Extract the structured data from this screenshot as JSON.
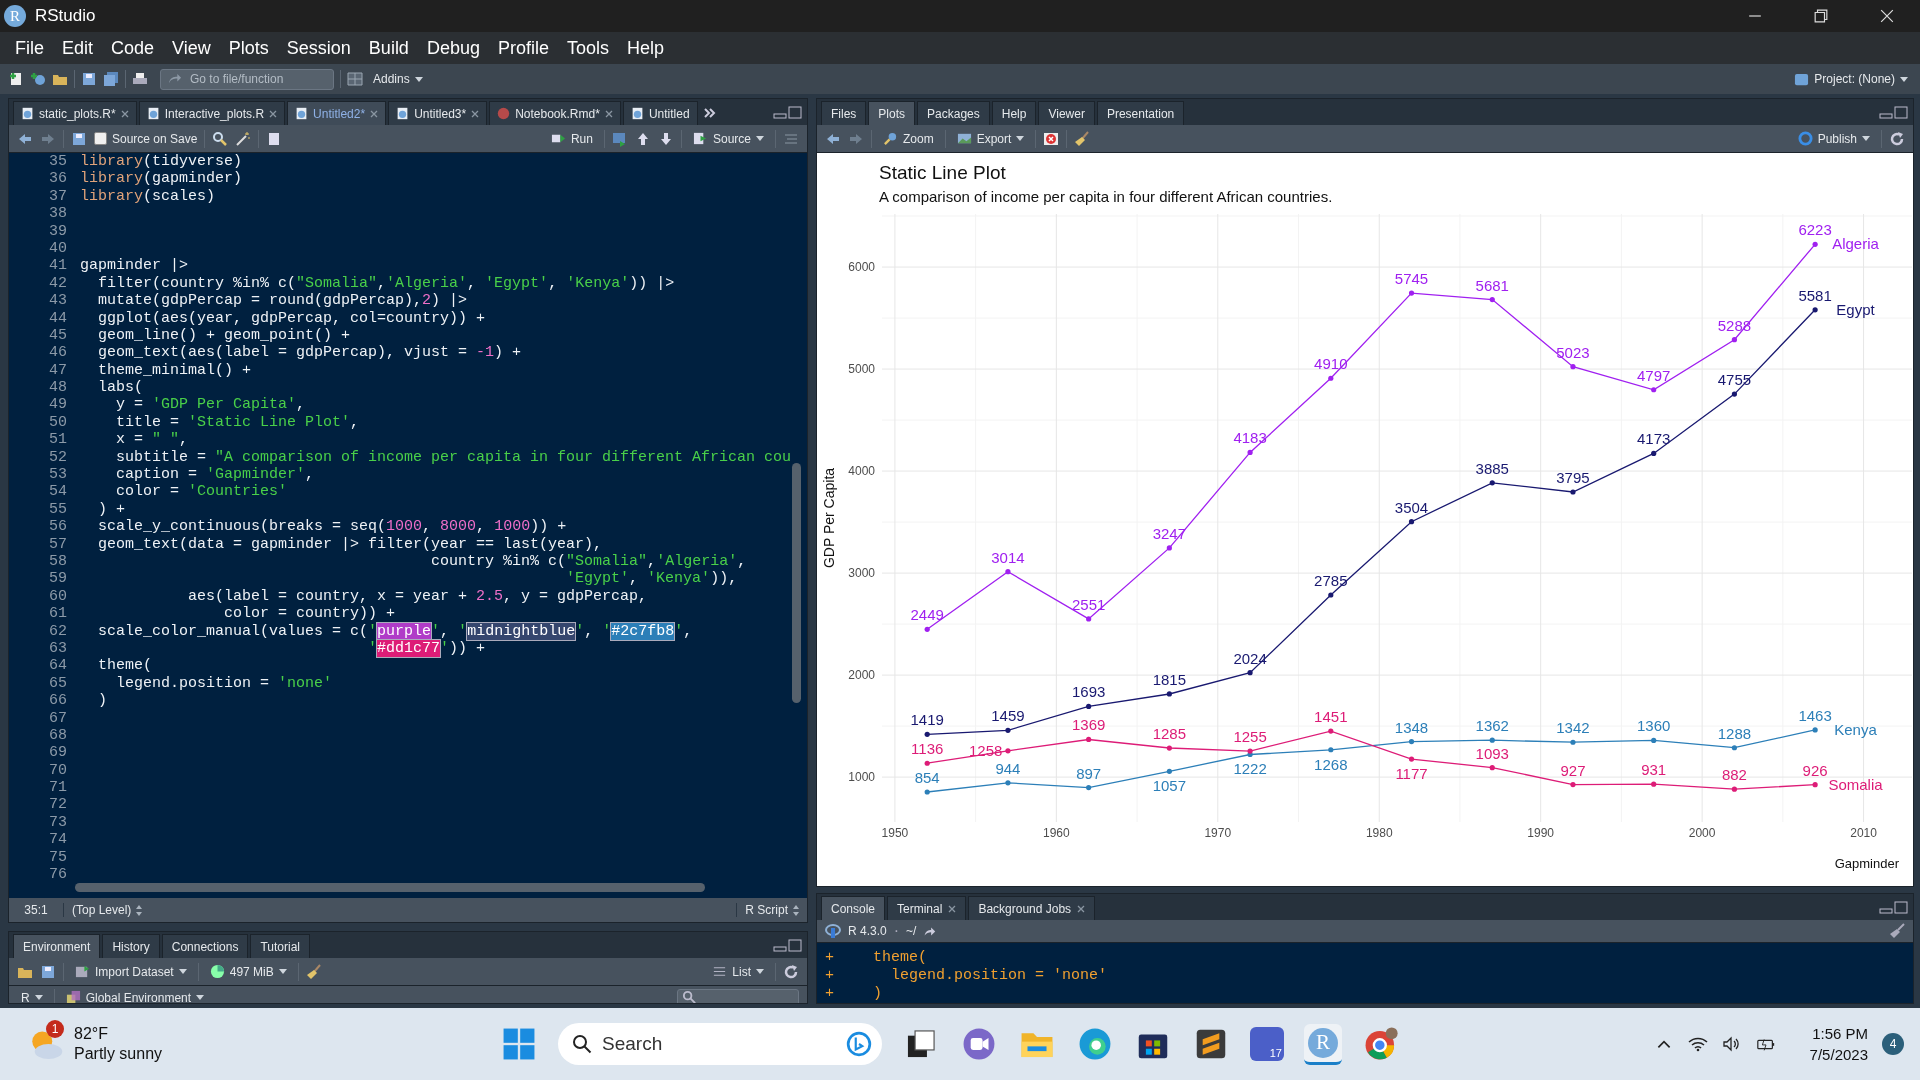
{
  "window": {
    "title": "RStudio",
    "logo_letter": "R"
  },
  "menu": [
    "File",
    "Edit",
    "Code",
    "View",
    "Plots",
    "Session",
    "Build",
    "Debug",
    "Profile",
    "Tools",
    "Help"
  ],
  "toolbar": {
    "goto_placeholder": "Go to file/function",
    "addins": "Addins",
    "project": "Project: (None)"
  },
  "editor": {
    "tabs": [
      {
        "label": "static_plots.R*",
        "kind": "r",
        "selected": false,
        "closable": true
      },
      {
        "label": "Interactive_plots.R",
        "kind": "r",
        "selected": false,
        "closable": true
      },
      {
        "label": "Untitled2*",
        "kind": "r",
        "selected": true,
        "closable": true
      },
      {
        "label": "Untitled3*",
        "kind": "r",
        "selected": false,
        "closable": true
      },
      {
        "label": "Notebook.Rmd*",
        "kind": "rmd",
        "selected": false,
        "closable": true
      },
      {
        "label": "Untitled",
        "kind": "r",
        "selected": false,
        "closable": false
      }
    ],
    "source_on_save": {
      "label": "Source on Save",
      "checked": false
    },
    "run": "Run",
    "source": "Source",
    "lines": [
      {
        "n": "35",
        "tokens": [
          {
            "kind": "fn",
            "text": "library"
          },
          {
            "kind": "code",
            "text": "(tidyverse)"
          }
        ]
      },
      {
        "n": "36",
        "tokens": [
          {
            "kind": "fn",
            "text": "library"
          },
          {
            "kind": "code",
            "text": "(gapminder)"
          }
        ]
      },
      {
        "n": "37",
        "tokens": [
          {
            "kind": "fn",
            "text": "library"
          },
          {
            "kind": "code",
            "text": "(scales)"
          }
        ]
      },
      {
        "n": "38"
      },
      {
        "n": "39"
      },
      {
        "n": "40"
      },
      {
        "n": "41",
        "tokens": [
          {
            "kind": "code",
            "text": "gapminder |>"
          }
        ]
      },
      {
        "n": "42",
        "tokens": [
          {
            "kind": "code",
            "text": "  filter(country %in% c("
          },
          {
            "kind": "str",
            "text": "\"Somalia\""
          },
          {
            "kind": "code",
            "text": ","
          },
          {
            "kind": "str",
            "text": "'Algeria'"
          },
          {
            "kind": "code",
            "text": ", "
          },
          {
            "kind": "str",
            "text": "'Egypt'"
          },
          {
            "kind": "code",
            "text": ", "
          },
          {
            "kind": "str",
            "text": "'Kenya'"
          },
          {
            "kind": "code",
            "text": ")) |>"
          }
        ]
      },
      {
        "n": "43",
        "tokens": [
          {
            "kind": "code",
            "text": "  mutate(gdpPercap = round(gdpPercap),"
          },
          {
            "kind": "num",
            "text": "2"
          },
          {
            "kind": "code",
            "text": ") |>"
          }
        ]
      },
      {
        "n": "44",
        "tokens": [
          {
            "kind": "code",
            "text": "  ggplot(aes(year, gdpPercap, col=country)) +"
          }
        ]
      },
      {
        "n": "45",
        "tokens": [
          {
            "kind": "code",
            "text": "  geom_line() + geom_point() +"
          }
        ]
      },
      {
        "n": "46",
        "tokens": [
          {
            "kind": "code",
            "text": "  geom_text(aes(label = gdpPercap), vjust = "
          },
          {
            "kind": "num",
            "text": "-1"
          },
          {
            "kind": "code",
            "text": ") +"
          }
        ]
      },
      {
        "n": "47",
        "tokens": [
          {
            "kind": "code",
            "text": "  theme_minimal() +"
          }
        ]
      },
      {
        "n": "48",
        "tokens": [
          {
            "kind": "code",
            "text": "  labs("
          }
        ]
      },
      {
        "n": "49",
        "tokens": [
          {
            "kind": "code",
            "text": "    y = "
          },
          {
            "kind": "str",
            "text": "'GDP Per Capita'"
          },
          {
            "kind": "code",
            "text": ","
          }
        ]
      },
      {
        "n": "50",
        "tokens": [
          {
            "kind": "code",
            "text": "    title = "
          },
          {
            "kind": "str",
            "text": "'Static Line Plot'"
          },
          {
            "kind": "code",
            "text": ","
          }
        ]
      },
      {
        "n": "51",
        "tokens": [
          {
            "kind": "code",
            "text": "    x = "
          },
          {
            "kind": "str",
            "text": "\" \""
          },
          {
            "kind": "code",
            "text": ","
          }
        ]
      },
      {
        "n": "52",
        "tokens": [
          {
            "kind": "code",
            "text": "    subtitle = "
          },
          {
            "kind": "str",
            "text": "\"A comparison of income per capita in four different African cou"
          }
        ]
      },
      {
        "n": "53",
        "tokens": [
          {
            "kind": "code",
            "text": "    caption = "
          },
          {
            "kind": "str",
            "text": "'Gapminder'"
          },
          {
            "kind": "code",
            "text": ","
          }
        ]
      },
      {
        "n": "54",
        "tokens": [
          {
            "kind": "code",
            "text": "    color = "
          },
          {
            "kind": "str",
            "text": "'Countries'"
          }
        ]
      },
      {
        "n": "55",
        "tokens": [
          {
            "kind": "code",
            "text": "  ) +"
          }
        ]
      },
      {
        "n": "56",
        "tokens": [
          {
            "kind": "code",
            "text": "  scale_y_continuous(breaks = seq("
          },
          {
            "kind": "num",
            "text": "1000"
          },
          {
            "kind": "code",
            "text": ", "
          },
          {
            "kind": "num",
            "text": "8000"
          },
          {
            "kind": "code",
            "text": ", "
          },
          {
            "kind": "num",
            "text": "1000"
          },
          {
            "kind": "code",
            "text": ")) +"
          }
        ]
      },
      {
        "n": "57",
        "tokens": [
          {
            "kind": "code",
            "text": "  geom_text(data = gapminder |> filter(year == last(year),"
          }
        ]
      },
      {
        "n": "58",
        "tokens": [
          {
            "kind": "code",
            "text": "                                       country %in% c("
          },
          {
            "kind": "str",
            "text": "\"Somalia\""
          },
          {
            "kind": "code",
            "text": ","
          },
          {
            "kind": "str",
            "text": "'Algeria'"
          },
          {
            "kind": "code",
            "text": ","
          }
        ]
      },
      {
        "n": "59",
        "tokens": [
          {
            "kind": "str",
            "text": "                                                      'Egypt'"
          },
          {
            "kind": "code",
            "text": ", "
          },
          {
            "kind": "str",
            "text": "'Kenya'"
          },
          {
            "kind": "code",
            "text": ")),"
          }
        ]
      },
      {
        "n": "60",
        "tokens": [
          {
            "kind": "code",
            "text": "            aes(label = country, x = year + "
          },
          {
            "kind": "num",
            "text": "2.5"
          },
          {
            "kind": "code",
            "text": ", y = gdpPercap,"
          }
        ]
      },
      {
        "n": "61",
        "tokens": [
          {
            "kind": "code",
            "text": "                color = country)) +"
          }
        ]
      },
      {
        "n": "62",
        "tokens": [
          {
            "kind": "code",
            "text": "  scale_color_manual(values = c("
          },
          {
            "kind": "str",
            "text": "'"
          },
          {
            "kind": "swatch",
            "text": "purple",
            "color": "#b03cc8"
          },
          {
            "kind": "str",
            "text": "'"
          },
          {
            "kind": "code",
            "text": ", "
          },
          {
            "kind": "str",
            "text": "'"
          },
          {
            "kind": "swatch",
            "text": "midnightblue",
            "color": "#35466e"
          },
          {
            "kind": "str",
            "text": "'"
          },
          {
            "kind": "code",
            "text": ", "
          },
          {
            "kind": "str",
            "text": "'"
          },
          {
            "kind": "swatch",
            "text": "#2c7fb8",
            "color": "#2c7fb8"
          },
          {
            "kind": "str",
            "text": "'"
          },
          {
            "kind": "code",
            "text": ","
          }
        ]
      },
      {
        "n": "63",
        "tokens": [
          {
            "kind": "str",
            "text": "                                '"
          },
          {
            "kind": "swatch",
            "text": "#dd1c77",
            "color": "#dd1c77"
          },
          {
            "kind": "str",
            "text": "'"
          },
          {
            "kind": "code",
            "text": ")) +"
          }
        ]
      },
      {
        "n": "64",
        "tokens": [
          {
            "kind": "code",
            "text": "  theme("
          }
        ]
      },
      {
        "n": "65",
        "tokens": [
          {
            "kind": "code",
            "text": "    legend.position = "
          },
          {
            "kind": "str",
            "text": "'none'"
          }
        ]
      },
      {
        "n": "66",
        "tokens": [
          {
            "kind": "code",
            "text": "  )"
          }
        ]
      },
      {
        "n": "67"
      },
      {
        "n": "68"
      },
      {
        "n": "69"
      },
      {
        "n": "70"
      },
      {
        "n": "71"
      },
      {
        "n": "72"
      },
      {
        "n": "73"
      },
      {
        "n": "74"
      },
      {
        "n": "75"
      },
      {
        "n": "76"
      }
    ],
    "status": {
      "position": "35:1",
      "scope": "(Top Level)",
      "file_type": "R Script"
    }
  },
  "environment": {
    "tabs": [
      {
        "label": "Environment",
        "selected": true
      },
      {
        "label": "History",
        "selected": false
      },
      {
        "label": "Connections",
        "selected": false
      },
      {
        "label": "Tutorial",
        "selected": false
      }
    ],
    "import": "Import Dataset",
    "memory": "497 MiB",
    "view": "List",
    "language": "R",
    "scope": "Global Environment"
  },
  "plots": {
    "tabs": [
      {
        "label": "Files",
        "selected": false
      },
      {
        "label": "Plots",
        "selected": true
      },
      {
        "label": "Packages",
        "selected": false
      },
      {
        "label": "Help",
        "selected": false
      },
      {
        "label": "Viewer",
        "selected": false
      },
      {
        "label": "Presentation",
        "selected": false
      }
    ],
    "zoom": "Zoom",
    "export": "Export",
    "publish": "Publish",
    "subtitle": "A comparison of income per capita in four different African countries.",
    "caption": "Gapminder",
    "chart_data": {
      "type": "line",
      "title": "Static Line Plot",
      "ylabel": "GDP Per Capita",
      "x": [
        1952,
        1957,
        1962,
        1967,
        1972,
        1977,
        1982,
        1987,
        1992,
        1997,
        2002,
        2007
      ],
      "series": [
        {
          "name": "Algeria",
          "color": "#a020f0",
          "values": [
            2449,
            3014,
            2551,
            3247,
            4183,
            4910,
            5745,
            5681,
            5023,
            4797,
            5288,
            6223
          ]
        },
        {
          "name": "Egypt",
          "color": "#191970",
          "values": [
            1419,
            1459,
            1693,
            1815,
            2024,
            2785,
            3504,
            3885,
            3795,
            4173,
            4755,
            5581
          ]
        },
        {
          "name": "Kenya",
          "color": "#2c7fb8",
          "values": [
            854,
            944,
            897,
            1057,
            1222,
            1268,
            1348,
            1362,
            1342,
            1360,
            1288,
            1463
          ]
        },
        {
          "name": "Somalia",
          "color": "#dd1c77",
          "values": [
            1136,
            1258,
            1369,
            1285,
            1255,
            1451,
            1177,
            1093,
            927,
            931,
            882,
            926
          ]
        }
      ],
      "xlim": [
        1949.2,
        2013
      ],
      "ylim": [
        560,
        6520
      ],
      "xticks": [
        1950,
        1960,
        1970,
        1980,
        1990,
        2000,
        2010
      ],
      "yticks": [
        1000,
        2000,
        3000,
        4000,
        5000,
        6000
      ],
      "grid": true,
      "data_labels": true
    }
  },
  "console": {
    "tabs": [
      {
        "label": "Console",
        "selected": true,
        "closable": false
      },
      {
        "label": "Terminal",
        "selected": false,
        "closable": true
      },
      {
        "label": "Background Jobs",
        "selected": false,
        "closable": true
      }
    ],
    "version": "R 4.3.0",
    "separator": "·",
    "path": "~/",
    "lines": [
      {
        "prompt": "+",
        "text": "  theme("
      },
      {
        "prompt": "+",
        "text": "    legend.position = 'none'"
      },
      {
        "prompt": "+",
        "text": "  )"
      }
    ]
  },
  "taskbar": {
    "weather": {
      "temp": "82°F",
      "condition": "Partly sunny",
      "badge": "1"
    },
    "search": "Search",
    "calendar_day": "17",
    "rstudio_letter": "R",
    "time": "1:56 PM",
    "date": "7/5/2023",
    "notifications": "4"
  }
}
